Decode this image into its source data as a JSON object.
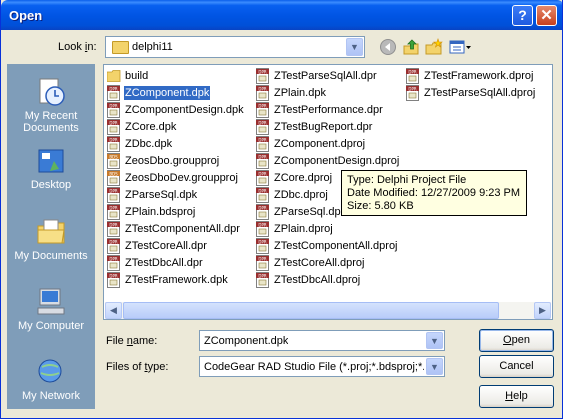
{
  "window": {
    "title": "Open",
    "help_glyph": "?",
    "close_glyph": "✕"
  },
  "lookin": {
    "label_pre": "Look ",
    "label_key": "i",
    "label_post": "n:",
    "value": "delphi11"
  },
  "places": [
    {
      "label": "My Recent Documents",
      "icon": "recent-documents-icon"
    },
    {
      "label": "Desktop",
      "icon": "desktop-icon"
    },
    {
      "label": "My Documents",
      "icon": "my-documents-icon"
    },
    {
      "label": "My Computer",
      "icon": "my-computer-icon"
    },
    {
      "label": "My Network",
      "icon": "my-network-icon"
    }
  ],
  "files": {
    "col1": [
      "build",
      "ZComponent.dpk",
      "ZComponentDesign.dpk",
      "ZCore.dpk",
      "ZDbc.dpk",
      "ZeosDbo.groupproj",
      "ZeosDboDev.groupproj",
      "ZParseSql.dpk",
      "ZPlain.bdsproj",
      "ZTestComponentAll.dpr",
      "ZTestCoreAll.dpr",
      "ZTestDbcAll.dpr",
      "ZTestFramework.dpk"
    ],
    "col2": [
      "ZTestParseSqlAll.dpr",
      "ZPlain.dpk",
      "ZTestPerformance.dpr",
      "ZTestBugReport.dpr",
      "ZComponent.dproj",
      "ZComponentDesign.dproj",
      "ZCore.dproj",
      "ZDbc.dproj",
      "ZParseSql.dpro",
      "ZPlain.dproj",
      "ZTestComponentAll.dproj",
      "ZTestCoreAll.dproj",
      "ZTestDbcAll.dproj"
    ],
    "col3": [
      "ZTestFramework.dproj",
      "ZTestParseSqlAll.dproj"
    ],
    "selected": "ZComponent.dpk"
  },
  "tooltip": {
    "line1": "Type: Delphi Project File",
    "line2": "Date Modified: 12/27/2009 9:23 PM",
    "line3": "Size: 5.80 KB"
  },
  "filename": {
    "label_pre": "File ",
    "label_key": "n",
    "label_post": "ame:",
    "value": "ZComponent.dpk"
  },
  "filetype": {
    "label_pre": "Files of ",
    "label_key": "t",
    "label_post": "ype:",
    "value": "CodeGear RAD Studio File (*.proj;*.bdsproj;*.groupproj)"
  },
  "buttons": {
    "open_key": "O",
    "open_rest": "pen",
    "cancel": "Cancel",
    "help_key": "H",
    "help_rest": "elp"
  },
  "colors": {
    "titlebar": "#0054E3",
    "selection": "#316AC5",
    "tooltip_bg": "#FFFFE1",
    "places_bg": "#7F9DB9",
    "dialog_bg": "#ECE9D8"
  }
}
